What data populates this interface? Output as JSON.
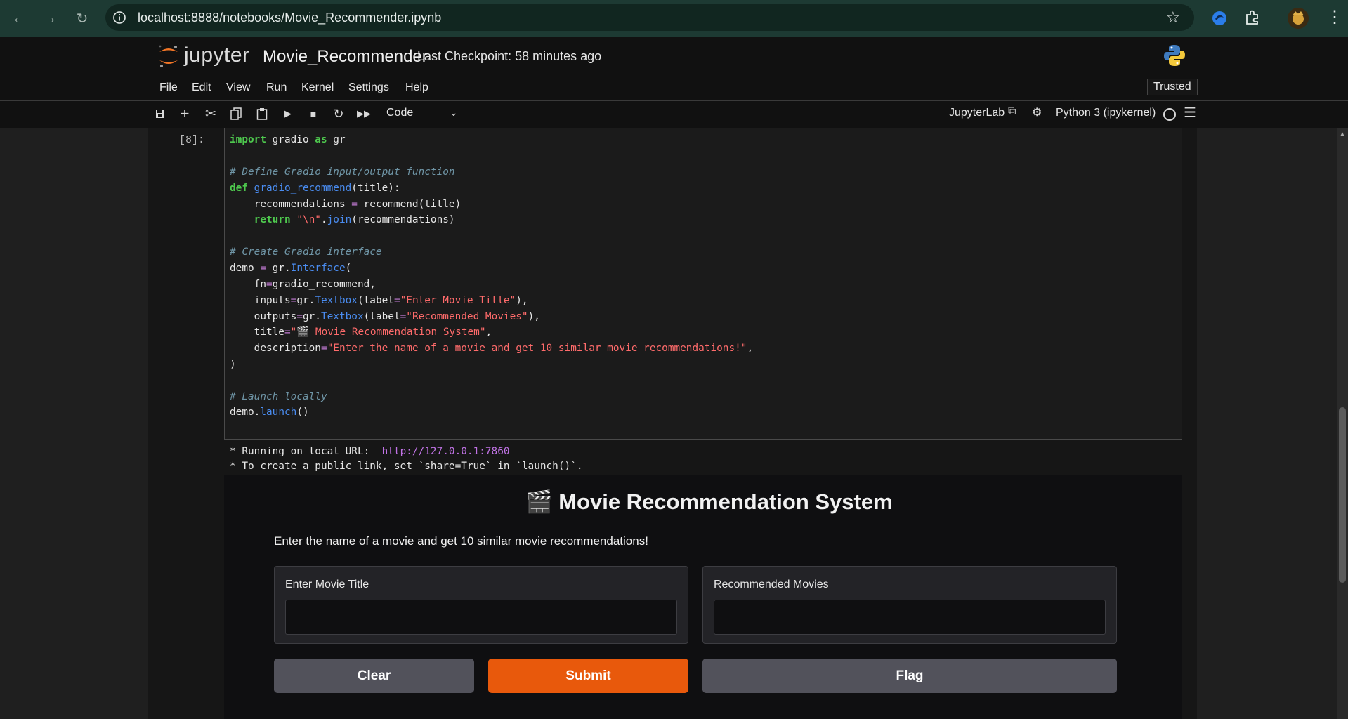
{
  "browser": {
    "url": "localhost:8888/notebooks/Movie_Recommender.ipynb"
  },
  "header": {
    "logo_text": "jupyter",
    "notebook_title": "Movie_Recommender",
    "checkpoint": "Last Checkpoint: 58 minutes ago"
  },
  "menu": {
    "items": [
      "File",
      "Edit",
      "View",
      "Run",
      "Kernel",
      "Settings",
      "Help"
    ],
    "trusted": "Trusted"
  },
  "toolbar": {
    "cell_type": "Code",
    "jupyterlab_link": "JupyterLab",
    "kernel": "Python 3 (ipykernel)"
  },
  "cell": {
    "prompt": "[8]:",
    "output_line1_prefix": "* Running on local URL:  ",
    "output_url": "http://127.0.0.1:7860",
    "output_line2": "* To create a public link, set `share=True` in `launch()`."
  },
  "gradio": {
    "title": "🎬 Movie Recommendation System",
    "description": "Enter the name of a movie and get 10 similar movie recommendations!",
    "input_label": "Enter Movie Title",
    "output_label": "Recommended Movies",
    "input_value": "",
    "output_value": "",
    "buttons": {
      "clear": "Clear",
      "submit": "Submit",
      "flag": "Flag"
    }
  },
  "colors": {
    "accent_orange": "#e8590c",
    "jupyter_orange": "#f37626"
  }
}
